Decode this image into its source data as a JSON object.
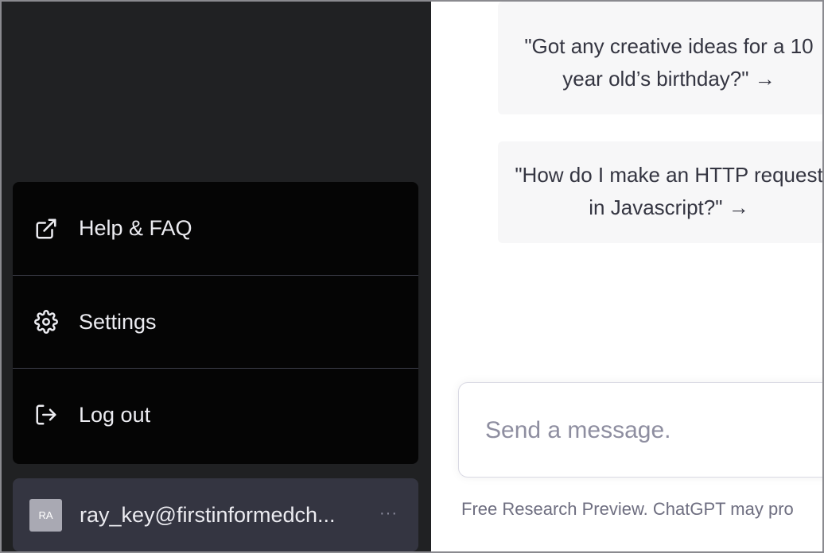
{
  "sidebar": {
    "menu": [
      {
        "label": "Help & FAQ",
        "icon": "external-link-icon"
      },
      {
        "label": "Settings",
        "icon": "gear-icon"
      },
      {
        "label": "Log out",
        "icon": "log-out-icon"
      }
    ],
    "user": {
      "avatar_initials": "RA",
      "email": "ray_key@firstinformedch...",
      "more_label": "···"
    }
  },
  "main": {
    "examples": [
      {
        "text": "\"Got any creative ideas for a 10 year old’s birthday?\" →"
      },
      {
        "text": "\"How do I make an HTTP request in Javascript?\" →"
      }
    ],
    "input": {
      "placeholder": "Send a message.",
      "value": ""
    },
    "disclaimer": "Free Research Preview. ChatGPT may pro"
  },
  "colors": {
    "sidebar_bg": "#202123",
    "menu_bg": "#050505",
    "user_row_bg": "#343541",
    "main_bg": "#ffffff",
    "example_bg": "#f7f7f8"
  }
}
